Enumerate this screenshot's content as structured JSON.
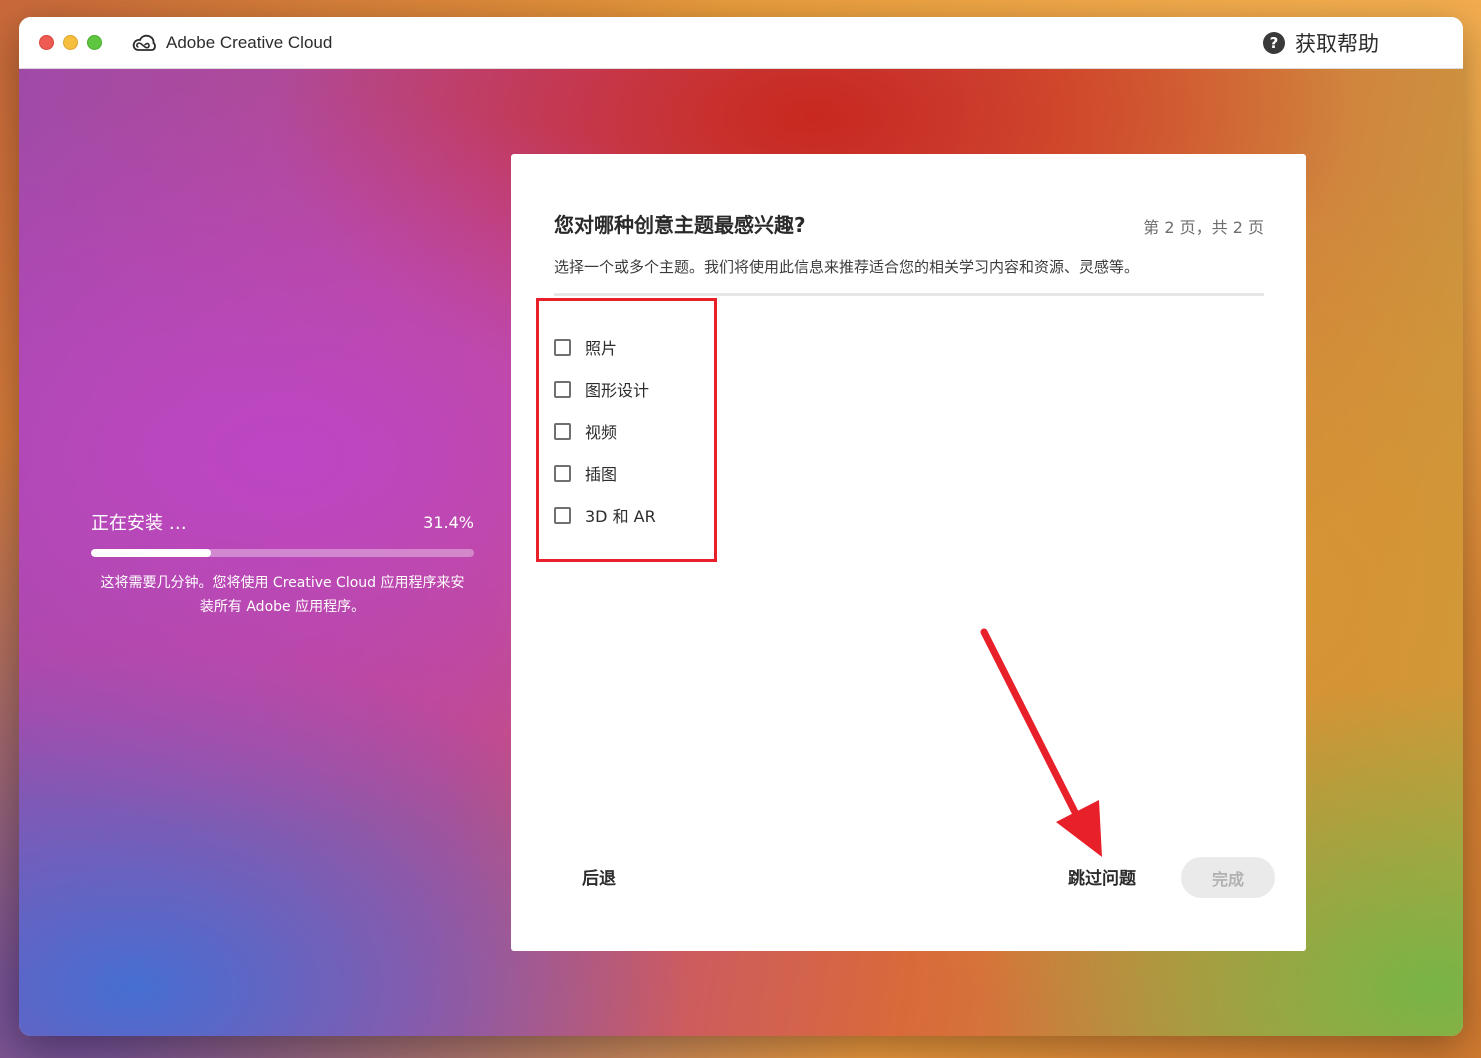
{
  "window": {
    "app_title": "Adobe Creative Cloud",
    "help_label": "获取帮助"
  },
  "install": {
    "status": "正在安装 …",
    "percent_text": "31.4%",
    "progress_fraction": 0.314,
    "note": "这将需要几分钟。您将使用 Creative Cloud 应用程序来安装所有 Adobe 应用程序。"
  },
  "dialog": {
    "title": "您对哪种创意主题最感兴趣?",
    "page_indicator": "第 2 页，共 2 页",
    "subtitle": "选择一个或多个主题。我们将使用此信息来推荐适合您的相关学习内容和资源、灵感等。",
    "topics": [
      {
        "label": "照片",
        "checked": false
      },
      {
        "label": "图形设计",
        "checked": false
      },
      {
        "label": "视频",
        "checked": false
      },
      {
        "label": "插图",
        "checked": false
      },
      {
        "label": "3D 和 AR",
        "checked": false
      }
    ],
    "back_label": "后退",
    "skip_label": "跳过问题",
    "done_label": "完成"
  },
  "annotation": {
    "highlight_color": "#e8202a"
  }
}
